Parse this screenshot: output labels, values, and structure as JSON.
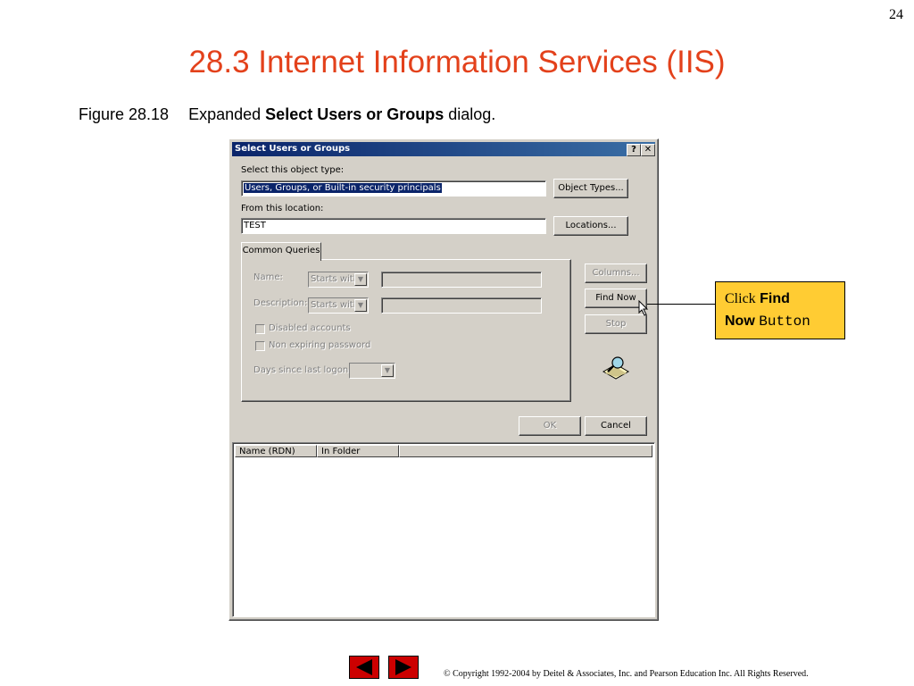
{
  "slide": {
    "page_number": "24",
    "title": "28.3 Internet Information Services (IIS)",
    "caption": {
      "figure": "Figure 28.18",
      "prefix": "Expanded",
      "bold": "Select Users or Groups",
      "suffix": "dialog."
    },
    "copyright": "© Copyright 1992-2004 by Deitel & Associates, Inc. and Pearson Education Inc. All Rights Reserved."
  },
  "dialog": {
    "title": "Select Users or Groups",
    "help_glyph": "?",
    "close_glyph": "✕",
    "object_type_label": "Select this object type:",
    "object_type_value": "Users, Groups, or Built-in security principals",
    "object_types_button": "Object Types...",
    "location_label": "From this location:",
    "location_value": "TEST",
    "locations_button": "Locations...",
    "tab_label": "Common Queries",
    "name_label": "Name:",
    "name_combo": "Starts with",
    "description_label": "Description:",
    "description_combo": "Starts with",
    "disabled_accounts": "Disabled accounts",
    "non_expiring": "Non expiring password",
    "days_label": "Days since last logon:",
    "columns_button": "Columns...",
    "find_now_button": "Find Now",
    "stop_button": "Stop",
    "ok_button": "OK",
    "cancel_button": "Cancel",
    "columns": [
      "Name (RDN)",
      "In Folder"
    ]
  },
  "callout": {
    "click": "Click",
    "find": "Find",
    "now": "Now",
    "button": "Button"
  },
  "colors": {
    "title": "#e3411b",
    "callout_bg": "#ffcc33",
    "titlebar": "#0a246a",
    "nav": "#cc0000"
  },
  "icons": {
    "search_icon": "search-icon",
    "cursor": "mouse-pointer-icon",
    "prev": "triangle-left-icon",
    "next": "triangle-right-icon"
  }
}
